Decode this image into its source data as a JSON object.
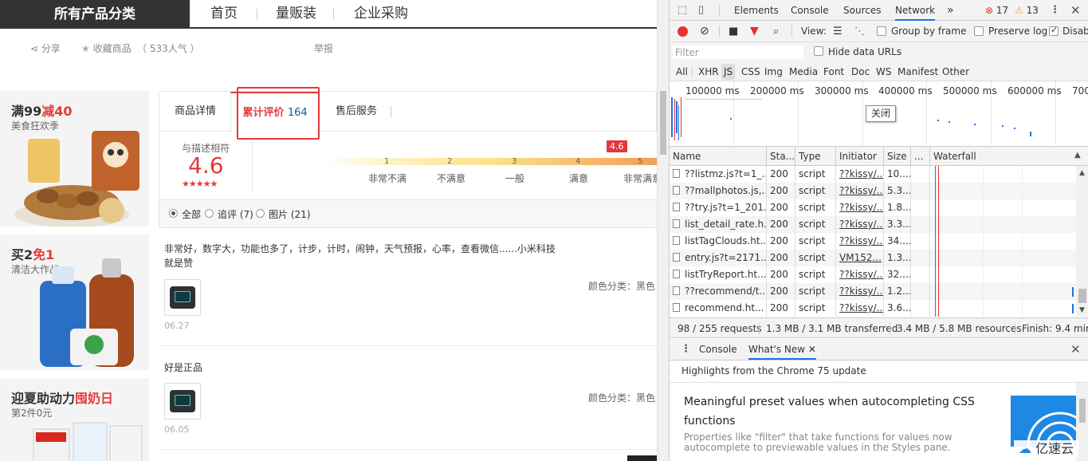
{
  "topnav": {
    "all_categories": "所有产品分类",
    "items": [
      "首页",
      "量贩装",
      "企业采购"
    ]
  },
  "share_row": {
    "share": "分享",
    "favorite": "收藏商品",
    "popularity": "（ 533人气 ）",
    "report": "举报"
  },
  "promos": [
    {
      "title_a": "满99",
      "title_b": "减40",
      "sub": "美食狂欢季"
    },
    {
      "title_a": "买2",
      "title_b": "免1",
      "sub": "清洁大作战"
    },
    {
      "title_a": "迎夏助动力",
      "title_b": "囤奶日",
      "sub": "第2件0元"
    }
  ],
  "tabs": {
    "details": "商品详情",
    "reviews": "累计评价",
    "review_count": "164",
    "after_sales": "售后服务"
  },
  "rating": {
    "label": "与描述相符",
    "score": "4.6",
    "stars": "★★★★★",
    "badge": "4.6",
    "scale_numbers": [
      "1",
      "2",
      "3",
      "4",
      "5"
    ],
    "scale_labels": [
      "非常不满",
      "不满意",
      "一般",
      "满意",
      "非常满意"
    ]
  },
  "filters": {
    "all": "全部",
    "followup": "追评 (7)",
    "images": "图片 (21)"
  },
  "reviews": [
    {
      "text1": "非常好，数字大，功能也多了，计步，计时，闹钟，天气预报，心率，查看微信......小米科技",
      "text2": "就是赞",
      "date": "06.27",
      "color": "颜色分类：黑色"
    },
    {
      "text1": "好是正品",
      "text2": "",
      "date": "06.05",
      "color": "颜色分类：黑色"
    }
  ],
  "devtools": {
    "tabs": [
      "Elements",
      "Console",
      "Sources",
      "Network"
    ],
    "more": "»",
    "errors": "17",
    "warnings": "13",
    "toolbar": {
      "view": "View:",
      "group_by_frame": "Group by frame",
      "preserve_log": "Preserve log",
      "disable_cache": "Disab"
    },
    "filter_placeholder": "Filter",
    "hide_data_urls": "Hide data URLs",
    "types": [
      "All",
      "XHR",
      "JS",
      "CSS",
      "Img",
      "Media",
      "Font",
      "Doc",
      "WS",
      "Manifest",
      "Other"
    ],
    "timeline_labels": [
      "100000 ms",
      "200000 ms",
      "300000 ms",
      "400000 ms",
      "500000 ms",
      "600000 ms",
      "700"
    ],
    "tooltip": "关闭",
    "columns": [
      "Name",
      "Sta...",
      "Type",
      "Initiator",
      "Size",
      "...",
      "Waterfall"
    ],
    "rows": [
      {
        "name": "??listmz.js?t=1_...",
        "status": "200",
        "type": "script",
        "initiator": "??kissy/...",
        "size": "10...."
      },
      {
        "name": "??mallphotos.js,...",
        "status": "200",
        "type": "script",
        "initiator": "??kissy/...",
        "size": "5.3..."
      },
      {
        "name": "??try.js?t=1_201...",
        "status": "200",
        "type": "script",
        "initiator": "??kissy/...",
        "size": "1.8..."
      },
      {
        "name": "list_detail_rate.h...",
        "status": "200",
        "type": "script",
        "initiator": "??kissy/...",
        "size": "3.3..."
      },
      {
        "name": "listTagClouds.ht...",
        "status": "200",
        "type": "script",
        "initiator": "??kissy/...",
        "size": "34...."
      },
      {
        "name": "entry.js?t=2171...",
        "status": "200",
        "type": "script",
        "initiator": "VM152...",
        "size": "1.3..."
      },
      {
        "name": "listTryReport.ht...",
        "status": "200",
        "type": "script",
        "initiator": "??kissy/...",
        "size": "32...."
      },
      {
        "name": "??recommend/t...",
        "status": "200",
        "type": "script",
        "initiator": "??kissy/...",
        "size": "1.2..."
      },
      {
        "name": "recommend.ht...",
        "status": "200",
        "type": "script",
        "initiator": "??kissy/...",
        "size": "3.6..."
      }
    ],
    "status": {
      "requests": "98 / 255 requests",
      "transferred": "1.3 MB / 3.1 MB transferred",
      "resources": "3.4 MB / 5.8 MB resources",
      "finish": "Finish: 9.4 min"
    },
    "drawer": {
      "console": "Console",
      "whats_new": "What's New",
      "highlights": "Highlights from the Chrome 75 update",
      "item_title_1": "Meaningful preset values when autocompleting CSS",
      "item_title_2": "functions",
      "item_desc_1": "Properties like \"filter\" that take functions for values now",
      "item_desc_2": "autocomplete to previewable values in the Styles pane."
    },
    "watermark": "亿速云"
  },
  "colors": {
    "accent_red": "#e4393c",
    "devtools_blue": "#1a73e8"
  }
}
